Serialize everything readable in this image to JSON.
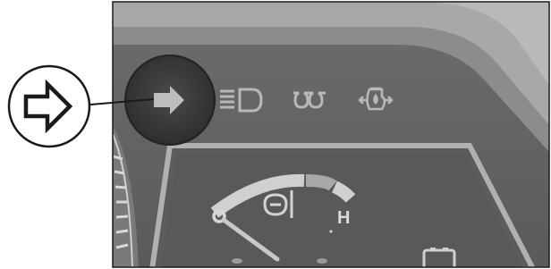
{
  "callout": {
    "icon": "turn-signal-indicator-icon"
  },
  "cluster": {
    "indicators": [
      {
        "icon": "turn-signal-arrow-icon",
        "highlighted": true
      },
      {
        "icon": "headlight-high-beam-icon",
        "highlighted": false
      },
      {
        "icon": "glow-plug-coil-icon",
        "highlighted": false
      },
      {
        "icon": "engine-oil-pressure-icon",
        "highlighted": false
      }
    ],
    "coolant_gauge": {
      "icon": "coolant-temperature-icon",
      "low_label": "C",
      "high_label": "H"
    },
    "bottom_right_icon": "battery-charge-icon"
  },
  "colors": {
    "panel_dark": "#575757",
    "panel_mid": "#6a6a6a",
    "bezel": "#9a9a9a",
    "symbol": "#c7c7c7",
    "highlight_ring": "#2a2a2a"
  }
}
